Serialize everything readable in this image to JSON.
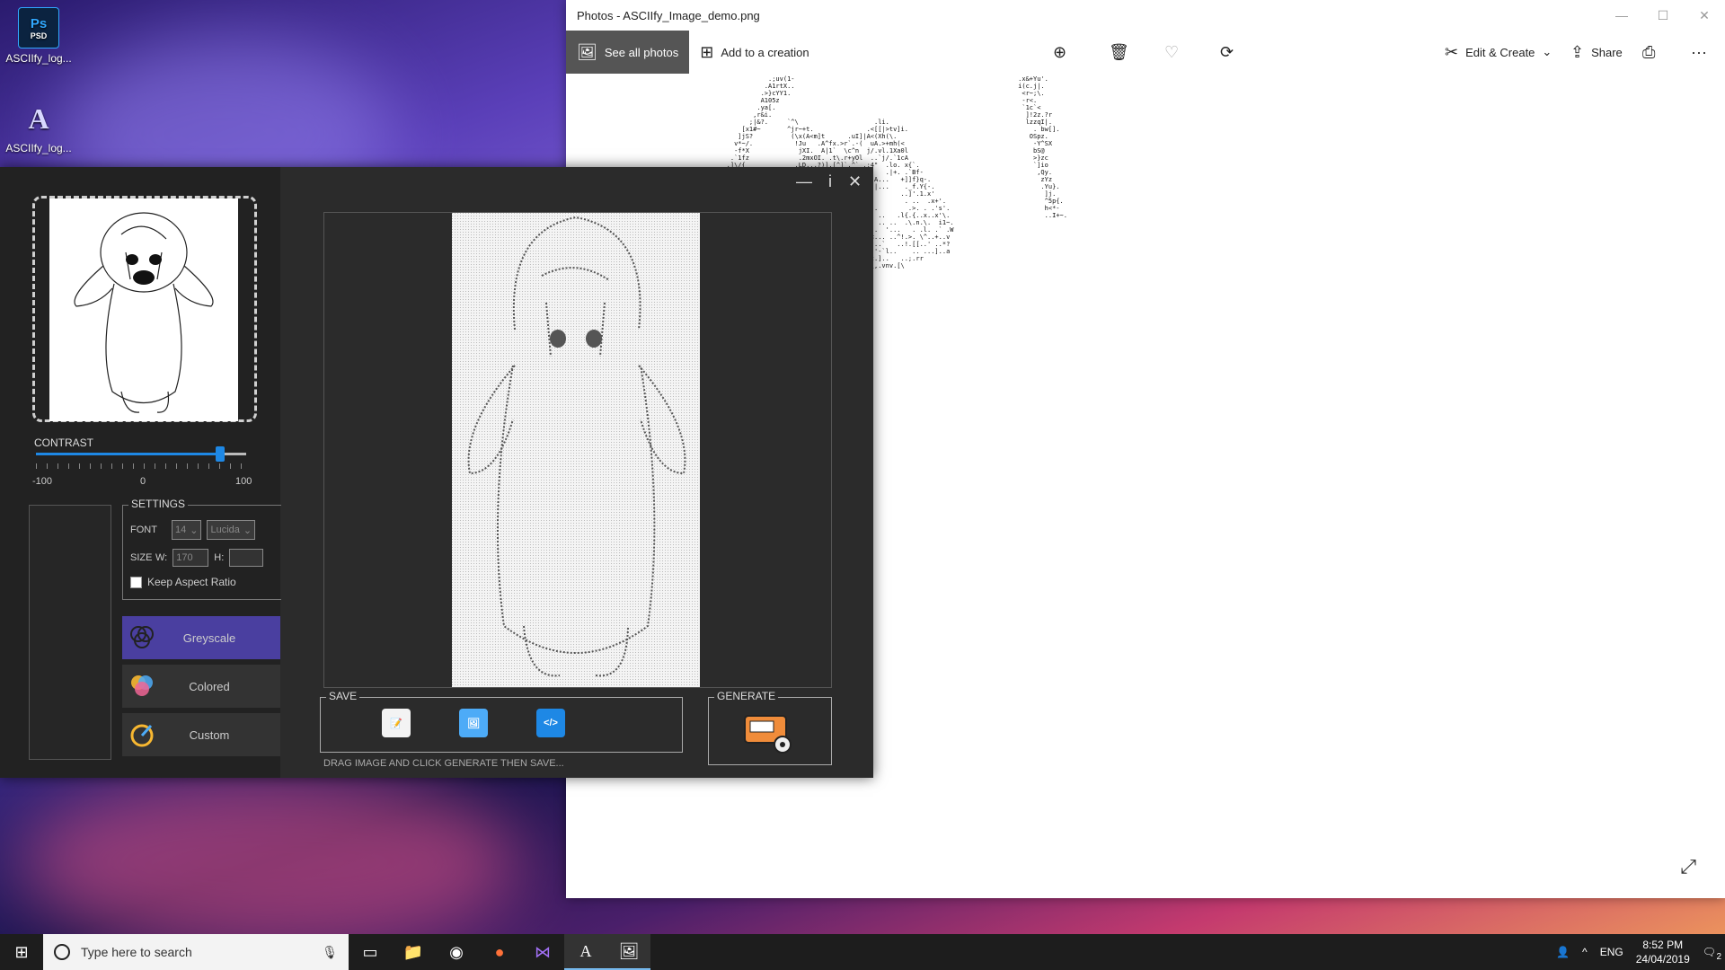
{
  "desktop": {
    "icons": [
      {
        "label": "ASCIIfy_log...",
        "icon": "photoshop-psd-icon",
        "badge": "Ps",
        "sub": "PSD"
      },
      {
        "label": "ASCIIfy_log...",
        "icon": "asciify-logo-icon",
        "badge": "A"
      }
    ]
  },
  "photos": {
    "title": "Photos - ASCIIfy_Image_demo.png",
    "window_controls": [
      "—",
      "☐",
      "✕"
    ],
    "toolbar": {
      "see_all": "See all photos",
      "add_creation": "Add to a creation",
      "edit_create": "Edit & Create",
      "share": "Share"
    },
    "ascii_art": "              .;uv(1-                                                           .x&+Yu'.\n             .A1rtX..                                                           i(c.j|.\n            .>}cYY1.                                                             <r~;\\.\n            A105z                                                                -r<.\n           .ya[.                                                                 `1c`<\n          ,r&i.                                                                   ]!2z.?r\n         ;|&?.     `^\\                    .li.                                    lzzqI|.\n       [x1#~       ^jr~+t.              .<[[|>tv]i.                                 . bw[].\n      ]jS?          (\\x(A<m]t      .uI]|A<(Xh(\\.                                   OSpz.\n     v*~/.           !Ju   .A^fx.>r`.-(  uA.>+mh(<                                  -Y^SX\n     -f*X             jXI.  A|1`  \\c^n  j/.vl.1Xa0l                                 bS@\n    .`1fz             .2mxOI. .t\\.r+yOl  ..`j/.`1cA                                 >}zc\n   .]\\/{             .LD...?)].[^]`.^` .;4\"  .lo. x{`.                              `]io\n   ^l]q             .A:'.    ^..vhi -<.i_-   .|+. .`Bf-                              ,Qy.\n  .}:Y`             .A:zZ...r\\      ..]Z .A...   +]]f}q-.                             zYz\n  .zz).             .A.f|x...'    .<+.^...|...    ._f.Y{-.                            .Yu}.\n  .+jX.             :1].                         ..]'.1.x'                             ]j.\n  .nx'.             ..A..\"...'.. ....             . ..  .x+'.                          ^5p{.\n  .p\"?              .vi..{..x..;..j..n  . .        .>. . .'s'.                         h<*-\n  .[w.(             ...J. .(... '..-_~.[A  ..   .l{.{..x..x'\\.                         ..I+~.\n   .r.1             ...tJ.  ...   (,...!.' .. ..  .\\.n.\\.  i1~.\n    .?(/            ...\".:.. ....  ..>>.. .  '...   . .l. .` .W\n    `v`j!             _.  ..[.\\I..... .iI<... ..^!.>. \\^..+..v\n     `}w.              ..~'-|.{....t.|l`/J..`   ..!.[[..' ..*?\n      \\k[.              ..`.   .[... ..>+.'-`l..    .. ...]..a\n       `nt.              ..v.: .\\xv..]..`t.]..   ..;.rr\n        l|1               .|..[U.~.{..[.'\\,.vnv.[\\\n         .&1.              .--'..'-=-\\\n          )L.                .]>}.[.\n",
    "expand_icon": "expand-icon"
  },
  "app": {
    "window_controls": {
      "minimize": "—",
      "info": "i",
      "close": "✕"
    },
    "contrast": {
      "label": "CONTRAST",
      "min": "-100",
      "mid": "0",
      "max": "100",
      "value": 75
    },
    "settings": {
      "title": "SETTINGS",
      "font_label": "FONT",
      "font_size": "14",
      "font_name": "Lucida",
      "size_label": "SIZE",
      "w_label": "W:",
      "w_value": "170",
      "h_label": "H:",
      "h_value": "",
      "keep_aspect": "Keep Aspect Ratio"
    },
    "modes": [
      {
        "label": "Greyscale",
        "active": true,
        "icon": "greyscale-icon"
      },
      {
        "label": "Colored",
        "active": false,
        "icon": "colored-icon"
      },
      {
        "label": "Custom",
        "active": false,
        "icon": "custom-icon"
      }
    ],
    "save": {
      "title": "SAVE",
      "icons": [
        "save-text-icon",
        "save-image-icon",
        "save-html-icon"
      ]
    },
    "generate": {
      "title": "GENERATE",
      "icon": "generate-machine-icon"
    },
    "hint": "DRAG IMAGE AND CLICK GENERATE THEN SAVE..."
  },
  "taskbar": {
    "search_placeholder": "Type here to search",
    "language": "ENG",
    "time": "8:52 PM",
    "date": "24/04/2019",
    "notification_count": "2",
    "apps": [
      "task-view-icon",
      "file-explorer-icon",
      "chrome-icon",
      "firefox-icon",
      "visual-studio-icon",
      "asciify-icon",
      "photos-icon"
    ]
  }
}
